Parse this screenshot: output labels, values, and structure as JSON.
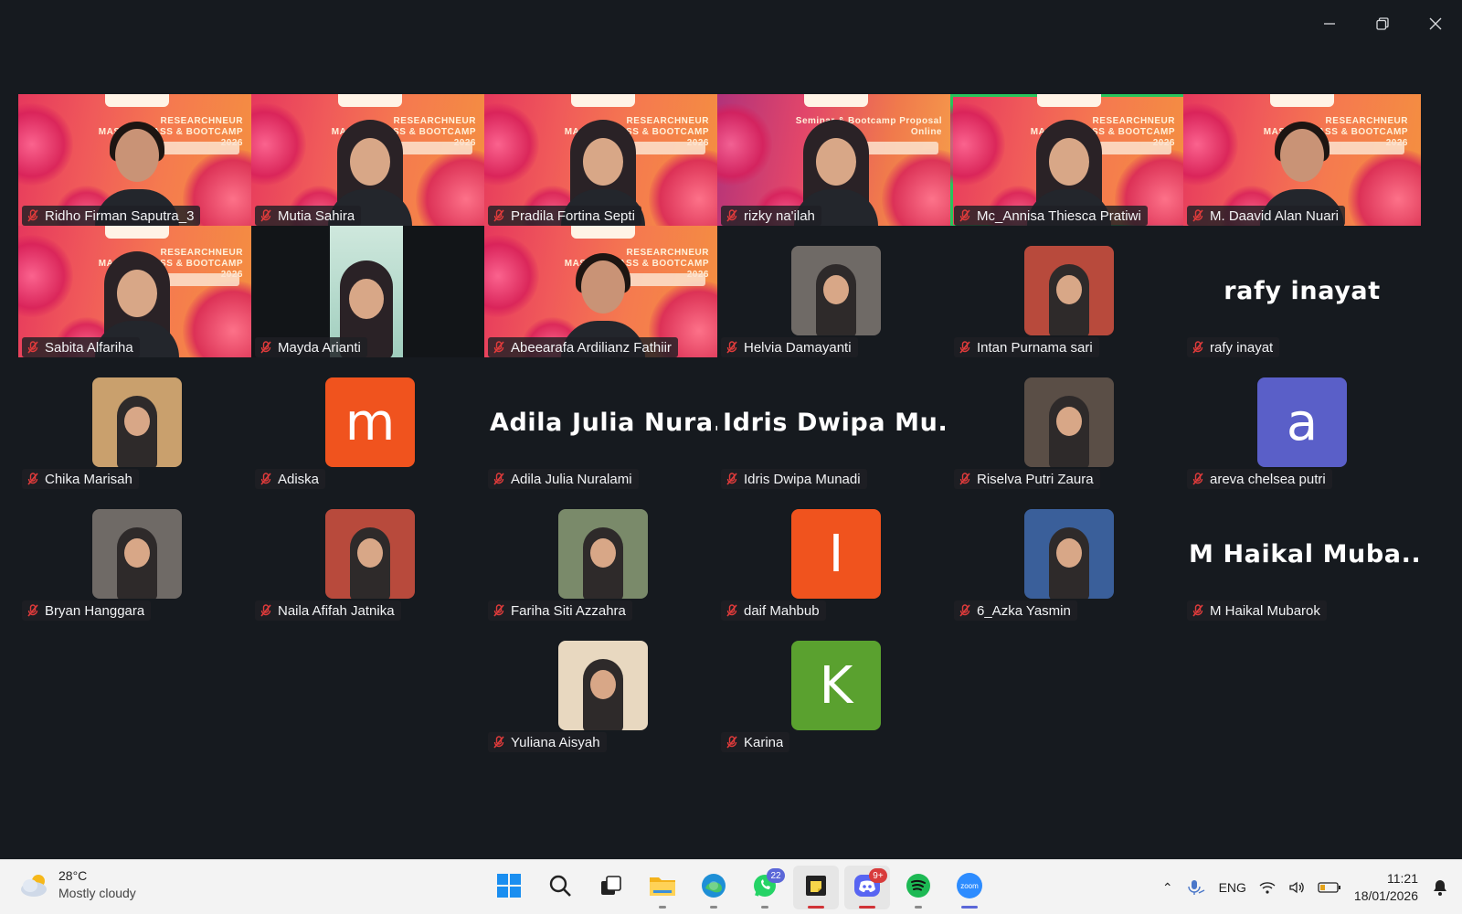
{
  "window": {
    "controls": [
      "minimize",
      "restore",
      "close"
    ]
  },
  "banner_text": "RESEARCHNEUR MASTERCLASS & BOOTCAMP 2026",
  "seminar_text": "Seminar & Bootcamp Proposal Online",
  "participants": [
    {
      "name": "Ridho Firman Saputra_3",
      "tile": "banner"
    },
    {
      "name": "Mutia Sahira",
      "tile": "banner"
    },
    {
      "name": "Pradila Fortina Septi",
      "tile": "banner"
    },
    {
      "name": "rizky na'ilah",
      "tile": "banner-alt"
    },
    {
      "name": "Mc_Annisa Thiesca Pratiwi",
      "tile": "banner",
      "active": true
    },
    {
      "name": "M. Daavid Alan Nuari",
      "tile": "banner"
    },
    {
      "name": "Sabita Alfariha",
      "tile": "banner"
    },
    {
      "name": "Mayda Arianti",
      "tile": "video"
    },
    {
      "name": "Abeearafa Ardilianz Fathiir",
      "tile": "banner"
    },
    {
      "name": "Helvia Damayanti",
      "tile": "photo"
    },
    {
      "name": "Intan Purnama sari",
      "tile": "photo"
    },
    {
      "name": "rafy inayat",
      "tile": "name",
      "display": "rafy inayat"
    },
    {
      "name": "Chika Marisah",
      "tile": "photo"
    },
    {
      "name": "Adiska",
      "tile": "letter",
      "letter": "m",
      "color": "#f0531e"
    },
    {
      "name": "Adila Julia Nuralami",
      "tile": "name",
      "display": "Adila Julia Nura..."
    },
    {
      "name": "Idris Dwipa Munadi",
      "tile": "name",
      "display": "Idris Dwipa Mu..."
    },
    {
      "name": "Riselva Putri Zaura",
      "tile": "photo"
    },
    {
      "name": "areva chelsea putri",
      "tile": "letter",
      "letter": "a",
      "color": "#5a5fc8"
    },
    {
      "name": "Bryan Hanggara",
      "tile": "photo"
    },
    {
      "name": "Naila Afifah Jatnika",
      "tile": "photo"
    },
    {
      "name": "Fariha Siti Azzahra",
      "tile": "photo"
    },
    {
      "name": "daif Mahbub",
      "tile": "letter",
      "letter": "I",
      "color": "#f0531e"
    },
    {
      "name": "6_Azka Yasmin",
      "tile": "photo"
    },
    {
      "name": "M Haikal Mubarok",
      "tile": "name",
      "display": "M Haikal Muba..."
    },
    {
      "name": "Yuliana Aisyah",
      "tile": "photo"
    },
    {
      "name": "Karina",
      "tile": "letter",
      "letter": "K",
      "color": "#5aa12f"
    }
  ],
  "taskbar": {
    "weather": {
      "temp": "28°C",
      "desc": "Mostly cloudy"
    },
    "apps": [
      {
        "name": "start",
        "icon": "windows-icon"
      },
      {
        "name": "search",
        "icon": "search-icon"
      },
      {
        "name": "task-view",
        "icon": "task-view-icon"
      },
      {
        "name": "file-explorer",
        "icon": "folder-icon"
      },
      {
        "name": "edge",
        "icon": "edge-icon"
      },
      {
        "name": "whatsapp",
        "icon": "whatsapp-icon",
        "badge": "22"
      },
      {
        "name": "sticky-notes",
        "icon": "sticky-notes-icon",
        "active": true
      },
      {
        "name": "discord",
        "icon": "discord-icon",
        "badge": "9+",
        "active": true
      },
      {
        "name": "spotify",
        "icon": "spotify-icon"
      },
      {
        "name": "zoom",
        "icon": "zoom-icon",
        "label": "zoom"
      }
    ],
    "tray": {
      "lang": "ENG",
      "time": "11:21",
      "date": "18/01/2026"
    }
  }
}
